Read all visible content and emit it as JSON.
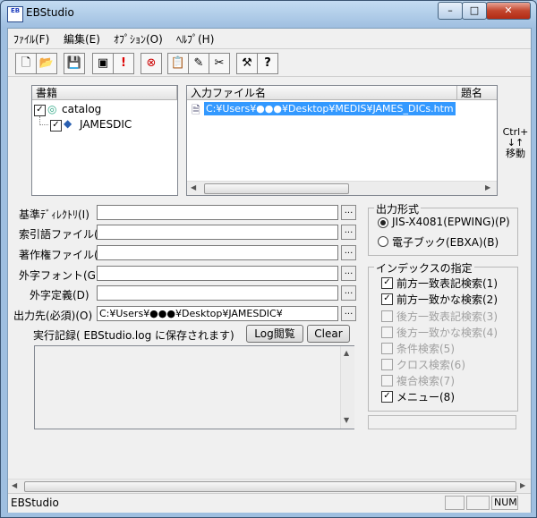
{
  "window": {
    "title": "EBStudio",
    "icon": "EB",
    "minimize": "–",
    "maximize": "□",
    "close": "✕"
  },
  "menu": [
    "ﾌｧｲﾙ(F)",
    "編集(E)",
    "ｵﾌﾟｼｮﾝ(O)",
    "ﾍﾙﾌﾟ(H)"
  ],
  "toolbar_icons": [
    "new-icon",
    "open-icon",
    "save-icon",
    "copy-icon",
    "exclamation-icon",
    "stop-icon",
    "paste-icon",
    "edit-icon",
    "cut-icon",
    "tools-icon",
    "help-icon"
  ],
  "toolbar_glyphs": [
    "🗋",
    "📂",
    "💾",
    "▣",
    "!",
    "⊗",
    "📋",
    "✎",
    "✂",
    "⚒",
    "?"
  ],
  "books": {
    "header": "書籍",
    "items": [
      {
        "label": "catalog",
        "checked": true
      },
      {
        "label": "JAMESDIC",
        "checked": true
      }
    ]
  },
  "input_files": {
    "header_file": "入力ファイル名",
    "header_title": "題名",
    "rows": [
      "C:¥Users¥●●●¥Desktop¥MEDIS¥JAMES_DICs.htm"
    ]
  },
  "move_hint": {
    "ctrl": "Ctrl+",
    "arrows": "↓↑",
    "move": "移動"
  },
  "fields": [
    {
      "label": "基準ﾃﾞｨﾚｸﾄﾘ(I)",
      "value": ""
    },
    {
      "label": "索引語ファイル(X)",
      "value": ""
    },
    {
      "label": "著作権ファイル(C)",
      "value": ""
    },
    {
      "label": "外字フォント(G)",
      "value": ""
    },
    {
      "label": "外字定義(D)",
      "value": ""
    },
    {
      "label": "出力先(必須)(O)",
      "value": "C:¥Users¥●●●¥Desktop¥JAMESDIC¥"
    }
  ],
  "ellipsis": "...",
  "log": {
    "label": "実行記録( EBStudio.log に保存されます)",
    "view_button": "Log閲覧",
    "clear_button": "Clear"
  },
  "output_format": {
    "title": "出力形式",
    "options": [
      {
        "label": "JIS-X4081(EPWING)(P)",
        "selected": true
      },
      {
        "label": "電子ブック(EBXA)(B)",
        "selected": false
      }
    ]
  },
  "index_spec": {
    "title": "インデックスの指定",
    "items": [
      {
        "label": "前方一致表記検索(1)",
        "checked": true,
        "enabled": true
      },
      {
        "label": "前方一致かな検索(2)",
        "checked": true,
        "enabled": true
      },
      {
        "label": "後方一致表記検索(3)",
        "checked": false,
        "enabled": false
      },
      {
        "label": "後方一致かな検索(4)",
        "checked": false,
        "enabled": false
      },
      {
        "label": "条件検索(5)",
        "checked": false,
        "enabled": false
      },
      {
        "label": "クロス検索(6)",
        "checked": false,
        "enabled": false
      },
      {
        "label": "複合検索(7)",
        "checked": false,
        "enabled": false
      },
      {
        "label": "メニュー(8)",
        "checked": true,
        "enabled": true
      }
    ]
  },
  "status": {
    "text": "EBStudio",
    "num": "NUM"
  }
}
